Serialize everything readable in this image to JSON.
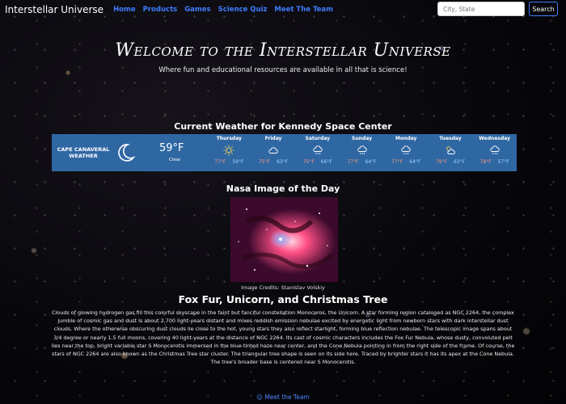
{
  "nav": {
    "brand": "Interstellar Universe",
    "links": [
      "Home",
      "Products",
      "Games",
      "Science Quiz",
      "Meet The Team"
    ],
    "search_placeholder": "City, State",
    "search_button": "Search"
  },
  "hero": {
    "title": "Welcome to the Interstellar Universe",
    "subtitle": "Where fun and educational resources are available in all that is science!"
  },
  "weather": {
    "title": "Current Weather for Kennedy Space Center",
    "location": "CAPE CANAVERAL WEATHER",
    "current_temp": "59°F",
    "current_condition": "Clear",
    "current_icon": "moon-icon",
    "forecast": [
      {
        "day": "Thursday",
        "icon": "sun-icon",
        "high": "77°F",
        "low": "59°F"
      },
      {
        "day": "Friday",
        "icon": "cloud-icon",
        "high": "75°F",
        "low": "63°F"
      },
      {
        "day": "Saturday",
        "icon": "rain-cloud-icon",
        "high": "75°F",
        "low": "66°F"
      },
      {
        "day": "Sunday",
        "icon": "rain-cloud-icon",
        "high": "77°F",
        "low": "64°F"
      },
      {
        "day": "Monday",
        "icon": "rain-cloud-icon",
        "high": "77°F",
        "low": "64°F"
      },
      {
        "day": "Tuesday",
        "icon": "partly-cloudy-icon",
        "high": "79°F",
        "low": "63°F"
      },
      {
        "day": "Wednesday",
        "icon": "rain-cloud-icon",
        "high": "78°F",
        "low": "57°F"
      }
    ]
  },
  "apod": {
    "title": "Nasa Image of the Day",
    "credit": "Image Credits: Stanislav Volskiy",
    "headline": "Fox Fur, Unicorn, and Christmas Tree",
    "text": "Clouds of glowing hydrogen gas fill this colorful skyscape in the faint but fanciful constellation Monoceros, the Unicorn. A star forming region cataloged as NGC 2264, the complex jumble of cosmic gas and dust is about 2,700 light-years distant and mixes reddish emission nebulae excited by energetic light from newborn stars with dark interstellar dust clouds. Where the otherwise obscuring dust clouds lie close to the hot, young stars they also reflect starlight, forming blue reflection nebulae. The telescopic image spans about 3/4 degree or nearly 1.5 full moons, covering 40 light-years at the distance of NGC 2264. Its cast of cosmic characters includes the Fox Fur Nebula, whose dusty, convoluted pelt lies near the top, bright variable star S Monocerotis immersed in the blue-tinted haze near center, and the Cone Nebula pointing in from the right side of the frame. Of course, the stars of NGC 2264 are also known as the Christmas Tree star cluster. The triangular tree shape is seen on its side here. Traced by brighter stars it has its apex at the Cone Nebula. The tree's broader base is centered near S Monocerotis."
  },
  "footer": {
    "link_label": "Meet the Team",
    "link_icon": "team-icon"
  }
}
